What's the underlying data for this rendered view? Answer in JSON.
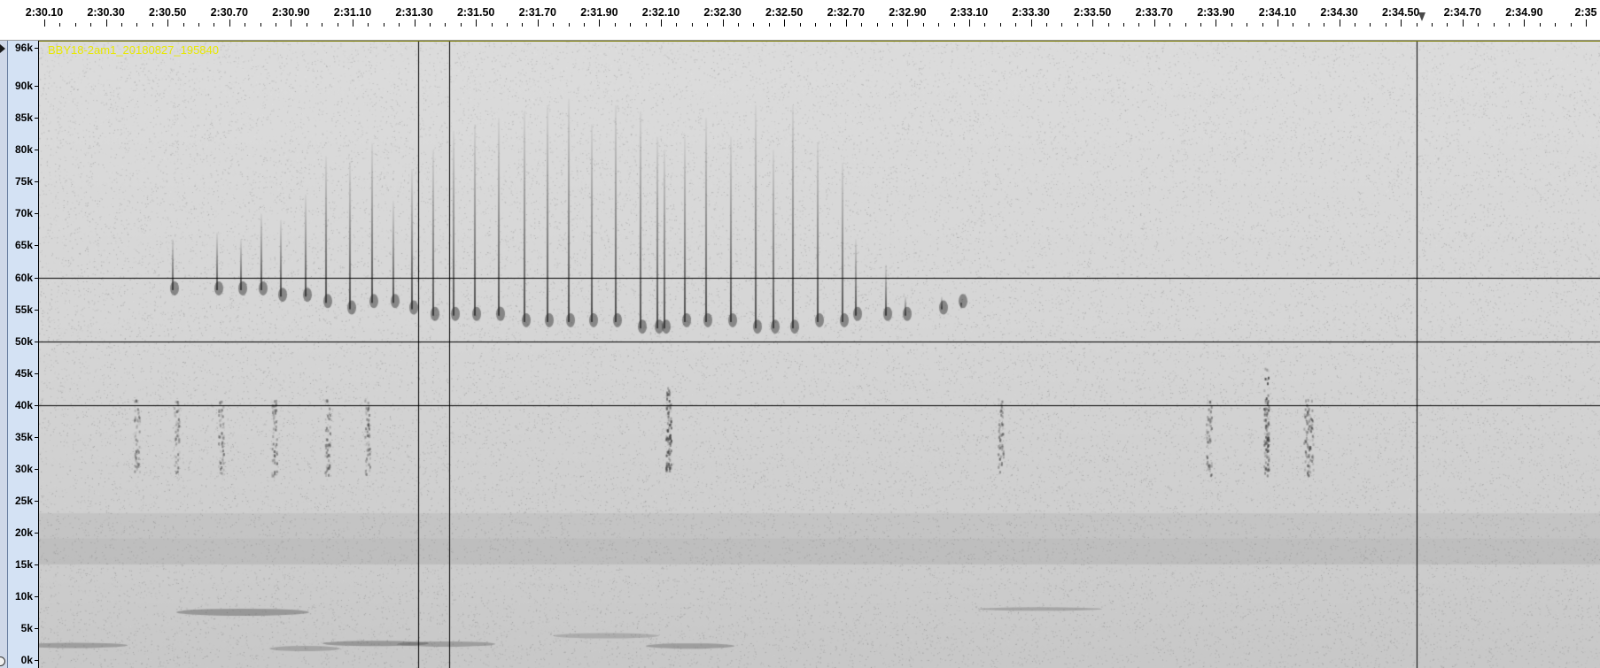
{
  "timeline": {
    "ticks": [
      "2:30.10",
      "2:30.30",
      "2:30.50",
      "2:30.70",
      "2:30.90",
      "2:31.10",
      "2:31.30",
      "2:31.50",
      "2:31.70",
      "2:31.90",
      "2:32.10",
      "2:32.30",
      "2:32.50",
      "2:32.70",
      "2:32.90",
      "2:33.10",
      "2:33.30",
      "2:33.50",
      "2:33.70",
      "2:33.90",
      "2:34.10",
      "2:34.30",
      "2:34.50",
      "2:34.70",
      "2:34.90",
      "2:35"
    ]
  },
  "track": {
    "clip_name": "BBY18-2am1_20180827_195840",
    "spectrogram_colors": {
      "background": "#d9d9d9",
      "grid": "#000000",
      "marks": "#2a2a2a"
    }
  },
  "frequency_ruler": {
    "labels": [
      "96k",
      "90k",
      "85k",
      "80k",
      "75k",
      "70k",
      "65k",
      "60k",
      "55k",
      "50k",
      "45k",
      "40k",
      "35k",
      "30k",
      "25k",
      "20k",
      "15k",
      "10k",
      "5k",
      "0k"
    ],
    "values_khz": [
      96,
      90,
      85,
      80,
      75,
      70,
      65,
      60,
      55,
      50,
      45,
      40,
      35,
      30,
      25,
      20,
      15,
      10,
      5,
      0
    ],
    "max_khz": 96
  },
  "icons": {
    "collapse": "collapse-arrow-icon",
    "track_circle": "circle-icon",
    "playhead": "playhead-marker-icon"
  }
}
